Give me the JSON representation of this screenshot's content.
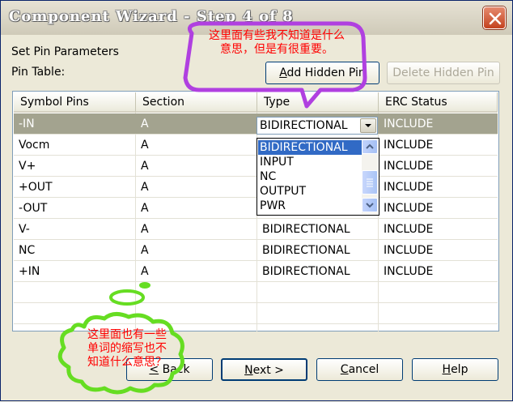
{
  "window": {
    "title": "Component Wizard - Step 4 of 8"
  },
  "section_title": "Set Pin Parameters",
  "pin_table_label": "Pin Table:",
  "buttons": {
    "add_hidden_pin": "Add Hidden Pin",
    "delete_hidden_pin": "Delete Hidden Pin",
    "back": "< Back",
    "next": "Next >",
    "cancel": "Cancel",
    "help": "Help"
  },
  "table": {
    "columns": [
      "Symbol Pins",
      "Section",
      "Type",
      "ERC Status"
    ],
    "rows": [
      {
        "pin": "-IN",
        "section": "A",
        "type": "BIDIRECTIONAL",
        "erc": "INCLUDE"
      },
      {
        "pin": "Vocm",
        "section": "A",
        "type": "",
        "erc": "INCLUDE"
      },
      {
        "pin": "V+",
        "section": "A",
        "type": "",
        "erc": "INCLUDE"
      },
      {
        "pin": "+OUT",
        "section": "A",
        "type": "",
        "erc": "INCLUDE"
      },
      {
        "pin": "-OUT",
        "section": "A",
        "type": "",
        "erc": "INCLUDE"
      },
      {
        "pin": "V-",
        "section": "A",
        "type": "BIDIRECTIONAL",
        "erc": "INCLUDE"
      },
      {
        "pin": "NC",
        "section": "A",
        "type": "BIDIRECTIONAL",
        "erc": "INCLUDE"
      },
      {
        "pin": "+IN",
        "section": "A",
        "type": "BIDIRECTIONAL",
        "erc": "INCLUDE"
      }
    ]
  },
  "type_dropdown": {
    "selected": "BIDIRECTIONAL",
    "options": [
      "BIDIRECTIONAL",
      "INPUT",
      "NC",
      "OUTPUT",
      "PWR"
    ]
  },
  "annotations": {
    "top": [
      "这里面有些我不知道是什么",
      "意思，但是有很重要。"
    ],
    "bottom": [
      "这里面也有一些",
      "单词的缩写也不",
      "知道什么意思？"
    ]
  },
  "colors": {
    "annotation_text": "#ff0000",
    "speech_bubble_purple": "#b040e0",
    "thought_cloud_green": "#66dd22",
    "selected_row": "#a3a38f",
    "dropdown_highlight": "#316ac5"
  }
}
